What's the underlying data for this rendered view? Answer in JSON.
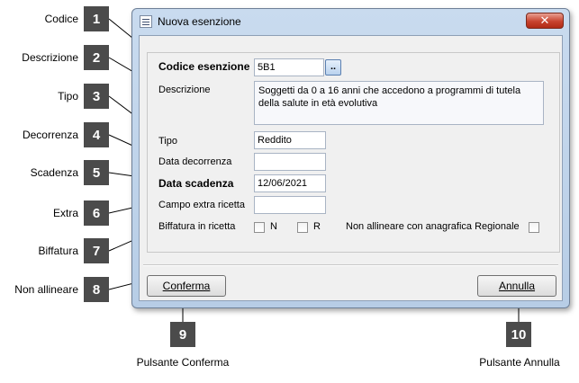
{
  "callouts": [
    {
      "num": "1",
      "label": "Codice"
    },
    {
      "num": "2",
      "label": "Descrizione"
    },
    {
      "num": "3",
      "label": "Tipo"
    },
    {
      "num": "4",
      "label": "Decorrenza"
    },
    {
      "num": "5",
      "label": "Scadenza"
    },
    {
      "num": "6",
      "label": "Extra"
    },
    {
      "num": "7",
      "label": "Biffatura"
    },
    {
      "num": "8",
      "label": "Non allineare"
    },
    {
      "num": "9",
      "label": "Pulsante Conferma"
    },
    {
      "num": "10",
      "label": "Pulsante Annulla"
    }
  ],
  "window": {
    "title": "Nuova esenzione",
    "close_label": "✕"
  },
  "form": {
    "codice_label": "Codice esenzione",
    "codice_value": "5B1",
    "lookup_label": "..",
    "descrizione_label": "Descrizione",
    "descrizione_value": "Soggetti da 0 a 16 anni che accedono a programmi di tutela della salute in età evolutiva",
    "tipo_label": "Tipo",
    "tipo_value": "Reddito",
    "decorrenza_label": "Data decorrenza",
    "decorrenza_value": "",
    "scadenza_label": "Data scadenza",
    "scadenza_value": "12/06/2021",
    "extra_label": "Campo extra ricetta",
    "extra_value": "",
    "biffatura_label": "Biffatura in ricetta",
    "biffatura_n": "N",
    "biffatura_r": "R",
    "non_allineare_label": "Non allineare con anagrafica Regionale"
  },
  "buttons": {
    "conferma": "Conferma",
    "annulla": "Annulla"
  }
}
